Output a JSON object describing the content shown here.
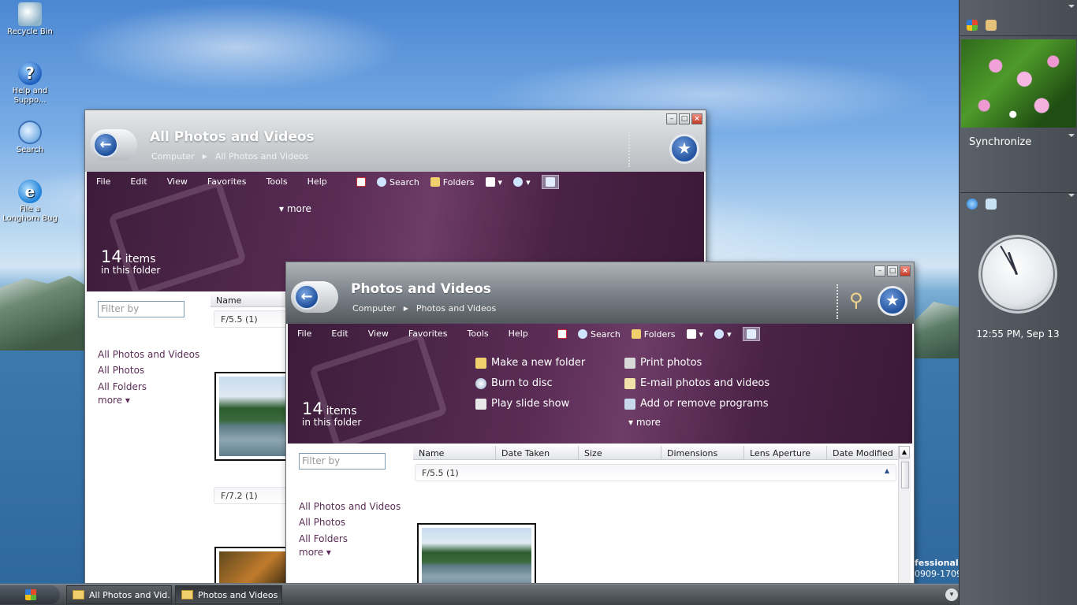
{
  "desktop": {
    "icons": [
      {
        "label": "Recycle Bin"
      },
      {
        "label": "Help and Suppo..."
      },
      {
        "label": "Search"
      },
      {
        "label": "File a Longhorn Bug"
      }
    ],
    "watermark": [
      "fessional",
      "0909-1709"
    ]
  },
  "sidebar": {
    "sync_label": "Synchronize",
    "clock_text": "12:55 PM, Sep 13"
  },
  "window_back": {
    "title": "All Photos and Videos",
    "breadcrumb": [
      "Computer",
      "All Photos and Videos"
    ],
    "menu": [
      "File",
      "Edit",
      "View",
      "Favorites",
      "Tools",
      "Help"
    ],
    "tools": {
      "search": "Search",
      "folders": "Folders"
    },
    "more": "more",
    "count_num": "14",
    "count_label": "items",
    "count_sub": "in this folder",
    "filter_placeholder": "Filter by",
    "nav": [
      "All Photos and Videos",
      "All Photos",
      "All Folders"
    ],
    "nav_more": "more",
    "columns": [
      "Name"
    ],
    "groups": [
      "F/5.5 (1)",
      "F/7.2 (1)"
    ]
  },
  "window_front": {
    "title": "Photos and Videos",
    "breadcrumb": [
      "Computer",
      "Photos and Videos"
    ],
    "menu": [
      "File",
      "Edit",
      "View",
      "Favorites",
      "Tools",
      "Help"
    ],
    "tools": {
      "search": "Search",
      "folders": "Folders"
    },
    "tasks_left": [
      "Make a new folder",
      "Burn to disc",
      "Play slide show"
    ],
    "tasks_right": [
      "Print photos",
      "E-mail photos and videos",
      "Add or remove programs"
    ],
    "more": "more",
    "count_num": "14",
    "count_label": "items",
    "count_sub": "in this folder",
    "filter_placeholder": "Filter by",
    "nav": [
      "All Photos and Videos",
      "All Photos",
      "All Folders"
    ],
    "nav_more": "more",
    "columns": [
      "Name",
      "Date Taken",
      "Size",
      "Dimensions",
      "Lens Aperture",
      "Date Modified"
    ],
    "groups": [
      "F/5.5 (1)"
    ]
  },
  "taskbar": {
    "buttons": [
      "All Photos and Vid...",
      "Photos and Videos"
    ]
  }
}
